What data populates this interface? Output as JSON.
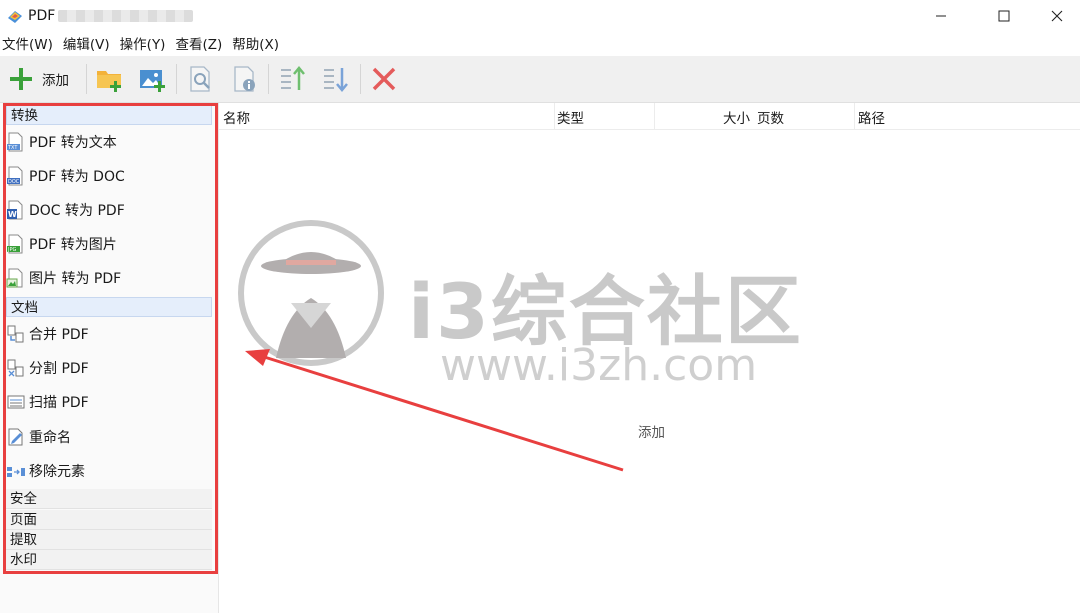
{
  "window": {
    "title": "PDF",
    "controls": [
      "minimize-icon",
      "maximize-icon",
      "close-icon"
    ]
  },
  "menu": [
    {
      "label": "文件(W)"
    },
    {
      "label": "编辑(V)"
    },
    {
      "label": "操作(Y)"
    },
    {
      "label": "查看(Z)"
    },
    {
      "label": "帮助(X)"
    }
  ],
  "toolbar": {
    "add_label": "添加",
    "icons": [
      "plus-icon",
      "add-folder-icon",
      "add-image-icon",
      "preview-icon",
      "info-icon",
      "move-up-icon",
      "move-down-icon",
      "delete-icon"
    ]
  },
  "sidebar": {
    "groups": [
      {
        "header": "转换",
        "items": [
          {
            "label": "PDF 转为文本",
            "icon": "txt-file-icon"
          },
          {
            "label": "PDF 转为 DOC",
            "icon": "doc-file-icon"
          },
          {
            "label": "DOC 转为 PDF",
            "icon": "word-file-icon"
          },
          {
            "label": "PDF 转为图片",
            "icon": "jpg-file-icon"
          },
          {
            "label": "图片 转为 PDF",
            "icon": "image-file-icon"
          }
        ]
      },
      {
        "header": "文档",
        "items": [
          {
            "label": "合并 PDF",
            "icon": "merge-icon"
          },
          {
            "label": "分割 PDF",
            "icon": "split-icon"
          },
          {
            "label": "扫描 PDF",
            "icon": "scan-icon"
          },
          {
            "label": "重命名",
            "icon": "rename-icon"
          },
          {
            "label": "移除元素",
            "icon": "remove-elements-icon"
          }
        ]
      },
      {
        "header": "安全",
        "items": []
      },
      {
        "header": "页面",
        "items": []
      },
      {
        "header": "提取",
        "items": []
      },
      {
        "header": "水印",
        "items": []
      }
    ]
  },
  "table": {
    "columns": [
      "名称",
      "类型",
      "大小",
      "页数",
      "路径"
    ]
  },
  "main": {
    "empty_hint": "添加"
  },
  "watermark": {
    "text": "i3综合社区",
    "url": "www.i3zh.com"
  },
  "colors": {
    "highlight_frame": "#e83f3f",
    "plus_green": "#3aa13a",
    "delete_red": "#e45b5b"
  }
}
